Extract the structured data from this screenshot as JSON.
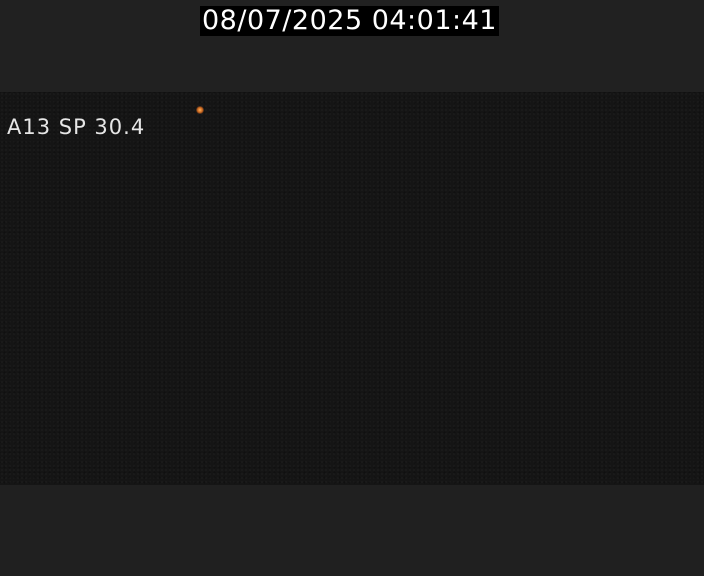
{
  "overlay": {
    "timestamp": "08/07/2025 04:01:41",
    "camera_label": "A13 SP 30.4"
  },
  "colors": {
    "background": "#202020",
    "video": "#151515",
    "timestamp_bg": "#000000",
    "text": "#ffffff",
    "light": "#ffb35a"
  }
}
